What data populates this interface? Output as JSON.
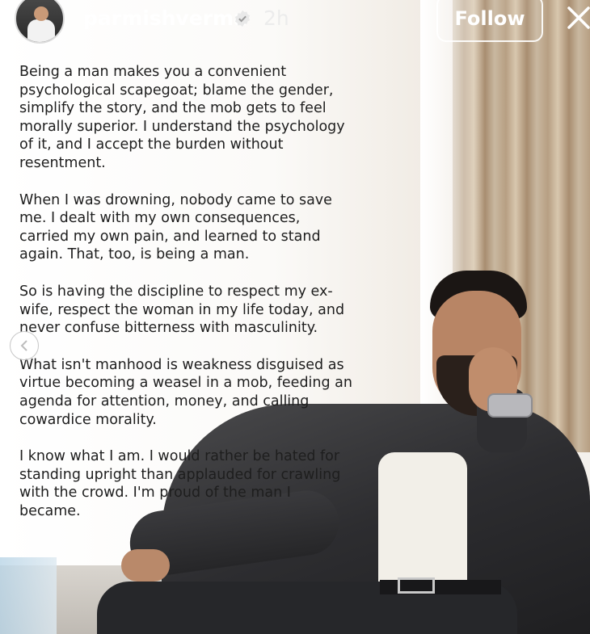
{
  "header": {
    "username": "parmishverma",
    "time": "2h",
    "follow_label": "Follow",
    "verified_icon": "verified-badge-icon",
    "close_icon": "close-icon"
  },
  "post": {
    "paragraphs": [
      "Being a man makes you a convenient\npsychological scapegoat; blame the gender,\nsimplify the story, and the mob gets to feel\nmorally superior. I understand the psychology\nof it, and I accept the burden without\nresentment.",
      "When I was drowning, nobody came to save\nme. I dealt with my own consequences,\ncarried my own pain, and learned to stand\nagain. That, too, is being a man.",
      "So is having the discipline to respect my ex-\nwife, respect the woman in my life today, and\nnever confuse bitterness with masculinity.",
      "What isn't manhood is weakness disguised as\nvirtue becoming a weasel in a mob, feeding an\nagenda for attention, money, and calling\ncowardice morality.",
      "I know what I am. I would rather be hated for\nstanding upright than applauded for crawling\nwith the crowd. I'm proud of the man I\nbecame."
    ]
  },
  "nav": {
    "prev_icon": "chevron-left-icon"
  },
  "colors": {
    "text": "#1e1e1e",
    "header_text": "#ffffff"
  }
}
